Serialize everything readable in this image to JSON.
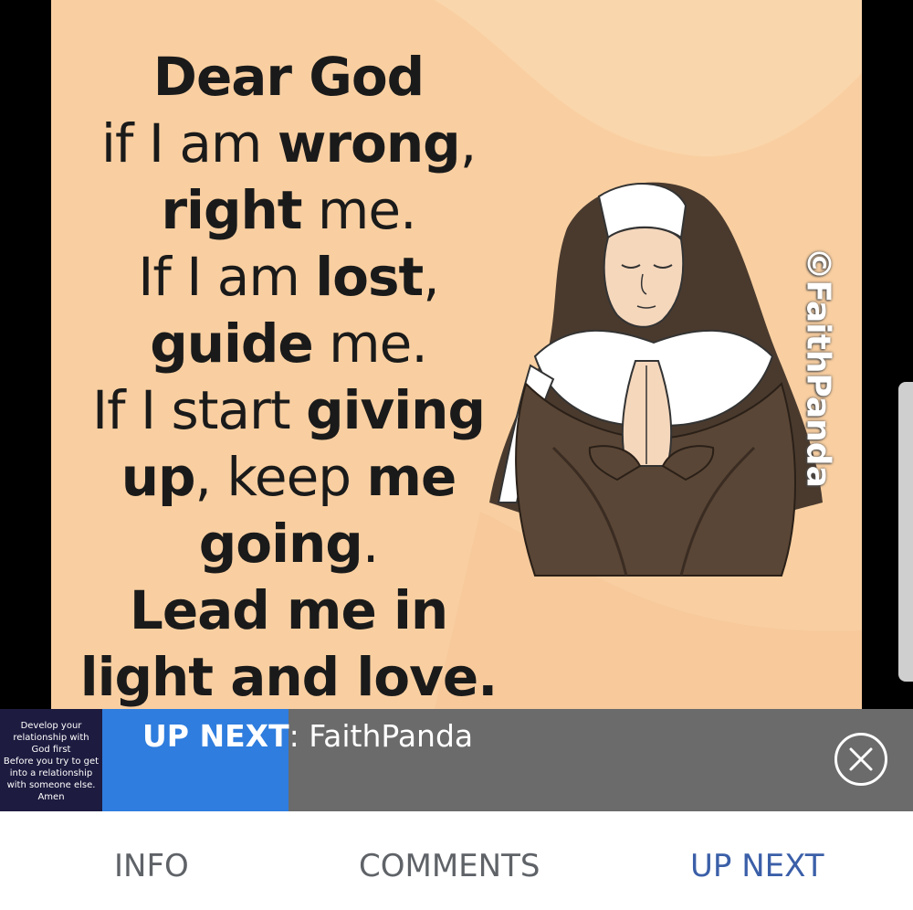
{
  "poster": {
    "lines": [
      {
        "a": "",
        "b": "Dear God",
        "c": ""
      },
      {
        "a": "if I am ",
        "b": "wrong",
        "c": ","
      },
      {
        "a": "",
        "b": "right",
        "c": " me."
      },
      {
        "a": "If I am ",
        "b": "lost",
        "c": ","
      },
      {
        "a": "",
        "b": "guide",
        "c": " me."
      },
      {
        "a": "If I start ",
        "b": "giving",
        "c": ""
      },
      {
        "a": "",
        "b": "up",
        "c": ", keep "
      },
      {
        "a": "",
        "b": "going",
        "c": "."
      },
      {
        "a": "",
        "b": "Lead me in",
        "c": ""
      },
      {
        "a": "",
        "b": "light and love.",
        "c": ""
      }
    ],
    "line7_bold2": "me",
    "watermark": "©FaithPanda"
  },
  "up_next": {
    "thumbnail_text": [
      "Develop your",
      "relationship with",
      "God first",
      "Before you try to get",
      "into a relationship",
      "with someone else.",
      "Amen"
    ],
    "label": "UP NEXT",
    "separator": ": ",
    "title": "FaithPanda",
    "progress": 0.23
  },
  "tabs": [
    {
      "label": "INFO",
      "active": false
    },
    {
      "label": "COMMENTS",
      "active": false
    },
    {
      "label": "UP NEXT",
      "active": true
    }
  ],
  "colors": {
    "poster_bg": "#f9cfa1",
    "progress": "#2f7dde",
    "bar_bg": "#6b6b6b",
    "active_tab": "#3b5fa8",
    "inactive_tab": "#5f6368"
  },
  "icons": {
    "close": "close-circle-icon"
  }
}
